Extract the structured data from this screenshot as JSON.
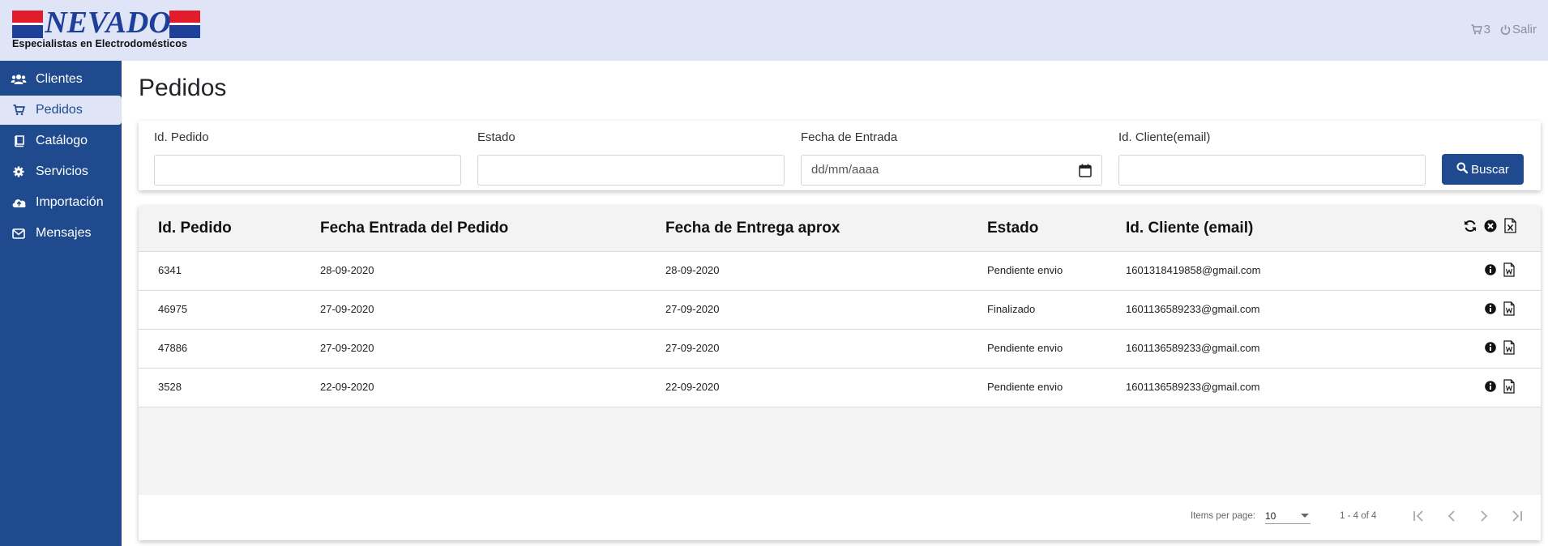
{
  "brand": {
    "name": "NEVADO",
    "tagline": "Especialistas en Electrodomésticos",
    "colors": {
      "red": "#e21c2b",
      "blue": "#1d3f99"
    }
  },
  "header": {
    "cart_count": "3",
    "logout_label": "Salir"
  },
  "sidebar": {
    "items": [
      {
        "label": "Clientes",
        "icon": "users-icon",
        "active": false
      },
      {
        "label": "Pedidos",
        "icon": "cart-icon",
        "active": true
      },
      {
        "label": "Catálogo",
        "icon": "book-icon",
        "active": false
      },
      {
        "label": "Servicios",
        "icon": "cog-icon",
        "active": false
      },
      {
        "label": "Importación",
        "icon": "cloud-upload-icon",
        "active": false
      },
      {
        "label": "Mensajes",
        "icon": "envelope-icon",
        "active": false
      }
    ]
  },
  "page": {
    "title": "Pedidos"
  },
  "filters": {
    "id_pedido": {
      "label": "Id. Pedido",
      "value": "",
      "placeholder": ""
    },
    "estado": {
      "label": "Estado",
      "value": "",
      "placeholder": ""
    },
    "fecha_entrada": {
      "label": "Fecha de Entrada",
      "value": "",
      "placeholder": "dd/mm/aaaa"
    },
    "id_cliente": {
      "label": "Id. Cliente(email)",
      "value": "",
      "placeholder": ""
    },
    "search_button": "Buscar"
  },
  "table": {
    "columns": [
      "Id. Pedido",
      "Fecha Entrada del Pedido",
      "Fecha de Entrega aprox",
      "Estado",
      "Id. Cliente (email)"
    ],
    "header_icons": [
      "refresh-icon",
      "clear-icon",
      "excel-export-icon"
    ],
    "row_icons": [
      "info-icon",
      "word-export-icon"
    ],
    "rows": [
      {
        "id": "6341",
        "entrada": "28-09-2020",
        "entrega": "28-09-2020",
        "estado": "Pendiente envio",
        "cliente": "1601318419858@gmail.com"
      },
      {
        "id": "46975",
        "entrada": "27-09-2020",
        "entrega": "27-09-2020",
        "estado": "Finalizado",
        "cliente": "1601136589233@gmail.com"
      },
      {
        "id": "47886",
        "entrada": "27-09-2020",
        "entrega": "27-09-2020",
        "estado": "Pendiente envio",
        "cliente": "1601136589233@gmail.com"
      },
      {
        "id": "3528",
        "entrada": "22-09-2020",
        "entrega": "22-09-2020",
        "estado": "Pendiente envio",
        "cliente": "1601136589233@gmail.com"
      }
    ]
  },
  "paginator": {
    "items_per_page_label": "Items per page:",
    "items_per_page": "10",
    "range": "1 - 4 of 4"
  }
}
